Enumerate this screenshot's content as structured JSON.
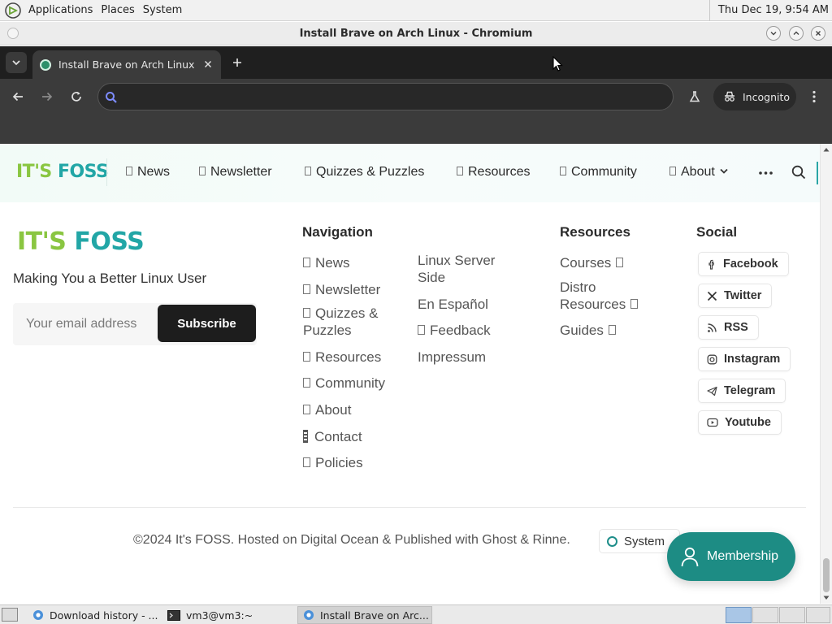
{
  "desktop": {
    "menus": [
      "Applications",
      "Places",
      "System"
    ],
    "clock": "Thu Dec 19,  9:54 AM"
  },
  "window": {
    "title": "Install Brave on Arch Linux - Chromium"
  },
  "browser": {
    "tab_title": "Install Brave on Arch Linux",
    "address_value": "",
    "incognito_label": "Incognito"
  },
  "site": {
    "logo_left": "IT'S",
    "logo_right": "FOSS",
    "nav": [
      "News",
      "Newsletter",
      "Quizzes & Puzzles",
      "Resources",
      "Community",
      "About"
    ],
    "tagline": "Making You a Better Linux User",
    "email_placeholder": "Your email address",
    "subscribe_label": "Subscribe",
    "navigation_heading": "Navigation",
    "navigation_col1": [
      "News",
      "Newsletter",
      "Quizzes &",
      "Puzzles",
      "Resources",
      "Community",
      "About",
      "Contact",
      "Policies"
    ],
    "navigation_col2": [
      "Linux Server",
      "Side",
      "En Español",
      "Feedback",
      "Impressum"
    ],
    "resources_heading": "Resources",
    "resources_links": [
      "Courses",
      "Distro",
      "Resources",
      "Guides"
    ],
    "social_heading": "Social",
    "social_links": [
      "Facebook",
      "Twitter",
      "RSS",
      "Instagram",
      "Telegram",
      "Youtube"
    ],
    "copyright": "©2024 It's FOSS. Hosted on Digital Ocean & Published with Ghost & Rinne.",
    "theme_label": "System",
    "membership_label": "Membership"
  },
  "taskbar": {
    "tasks": [
      "Download history - ...",
      "vm3@vm3:~",
      "Install Brave on Arc..."
    ]
  },
  "colors": {
    "brand_lime": "#8ac641",
    "brand_teal": "#22a6a6",
    "membership": "#1d8c84"
  }
}
